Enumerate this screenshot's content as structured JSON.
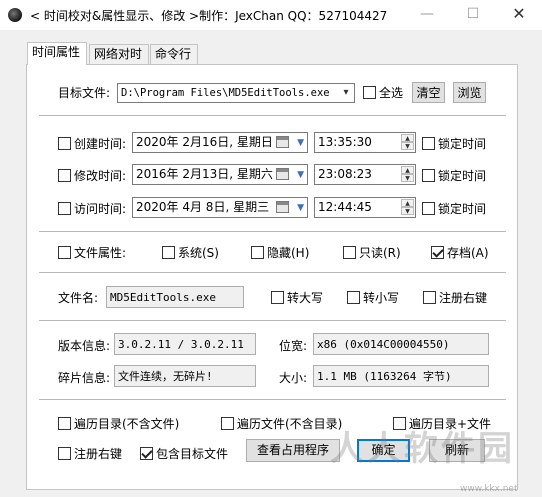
{
  "window": {
    "title": "< 时间校对&属性显示、修改 >制作：JexChan  QQ：527104427",
    "min_glyph": "—",
    "max_glyph": "☐",
    "close_glyph": "✕"
  },
  "tabs": [
    "时间属性",
    "网络对时",
    "命令行"
  ],
  "target": {
    "label": "目标文件:",
    "value": "D:\\Program Files\\MD5EditTools.exe",
    "select_all": "全选",
    "clear": "清空",
    "browse": "浏览"
  },
  "times": [
    {
      "label": "创建时间:",
      "date": "2020年 2月16日, 星期日",
      "time": "13:35:30",
      "lock": "锁定时间"
    },
    {
      "label": "修改时间:",
      "date": "2016年 2月13日, 星期六",
      "time": "23:08:23",
      "lock": "锁定时间"
    },
    {
      "label": "访问时间:",
      "date": "2020年 4月 8日, 星期三",
      "time": "12:44:45",
      "lock": "锁定时间"
    }
  ],
  "attrs": {
    "label": "文件属性:",
    "system": "系统(S)",
    "hidden": "隐藏(H)",
    "readonly": "只读(R)",
    "archive": "存档(A)",
    "archive_checked": true
  },
  "filename": {
    "label": "文件名:",
    "value": "MD5EditTools.exe",
    "upper": "转大写",
    "lower": "转小写",
    "reg": "注册右键"
  },
  "info": {
    "version_label": "版本信息:",
    "version_value": "3.0.2.11 / 3.0.2.11",
    "bits_label": "位宽:",
    "bits_value": "x86 (0x014C00004550)",
    "frag_label": "碎片信息:",
    "frag_value": "文件连续，无碎片!",
    "size_label": "大小:",
    "size_value": "1.1 MB (1163264 字节)"
  },
  "options": {
    "walk_dir": "遍历目录(不含文件)",
    "walk_file": "遍历文件(不含目录)",
    "walk_all": "遍历目录+文件",
    "reg_menu": "注册右键",
    "include_target": "包含目标文件",
    "include_target_checked": true
  },
  "buttons": {
    "view_proc": "查看占用程序",
    "ok": "确定",
    "refresh": "刷新"
  },
  "watermark": {
    "logo": "人人软件园",
    "url": "www.kkx.net"
  }
}
